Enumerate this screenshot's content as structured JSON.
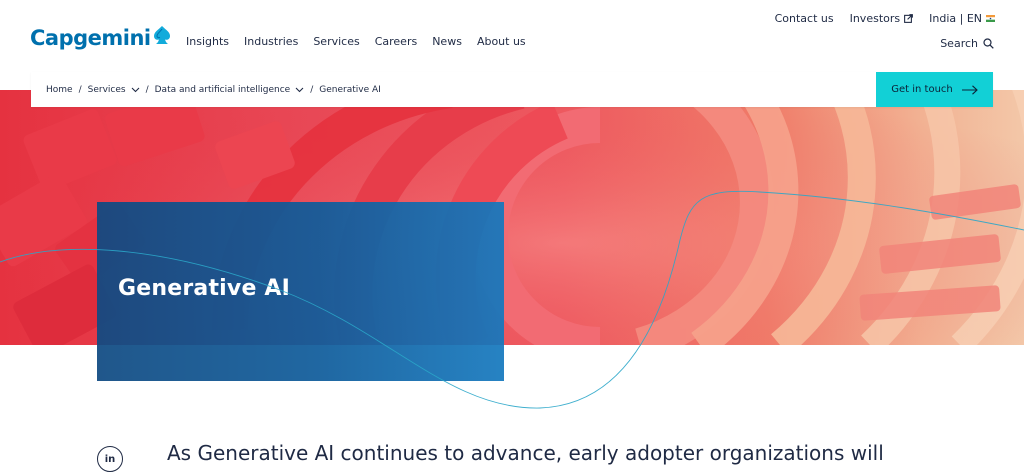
{
  "brand": {
    "name": "Capgemini"
  },
  "nav": {
    "items": [
      "Insights",
      "Industries",
      "Services",
      "Careers",
      "News",
      "About us"
    ]
  },
  "utility": {
    "contact": "Contact us",
    "investors": "Investors",
    "region": "India | EN",
    "search": "Search"
  },
  "breadcrumb": {
    "home": "Home",
    "services": "Services",
    "data_ai": "Data and artificial intelligence",
    "current": "Generative AI"
  },
  "cta": {
    "label": "Get in touch"
  },
  "hero": {
    "title": "Generative AI"
  },
  "body": {
    "intro": "As Generative AI continues to advance, early adopter organizations will",
    "share_linkedin": "in"
  },
  "colors": {
    "brand_blue": "#0070ad",
    "cta_cyan": "#12d0d6",
    "card_blue": "#0f5c9b",
    "text_dark": "#1f2a44"
  }
}
